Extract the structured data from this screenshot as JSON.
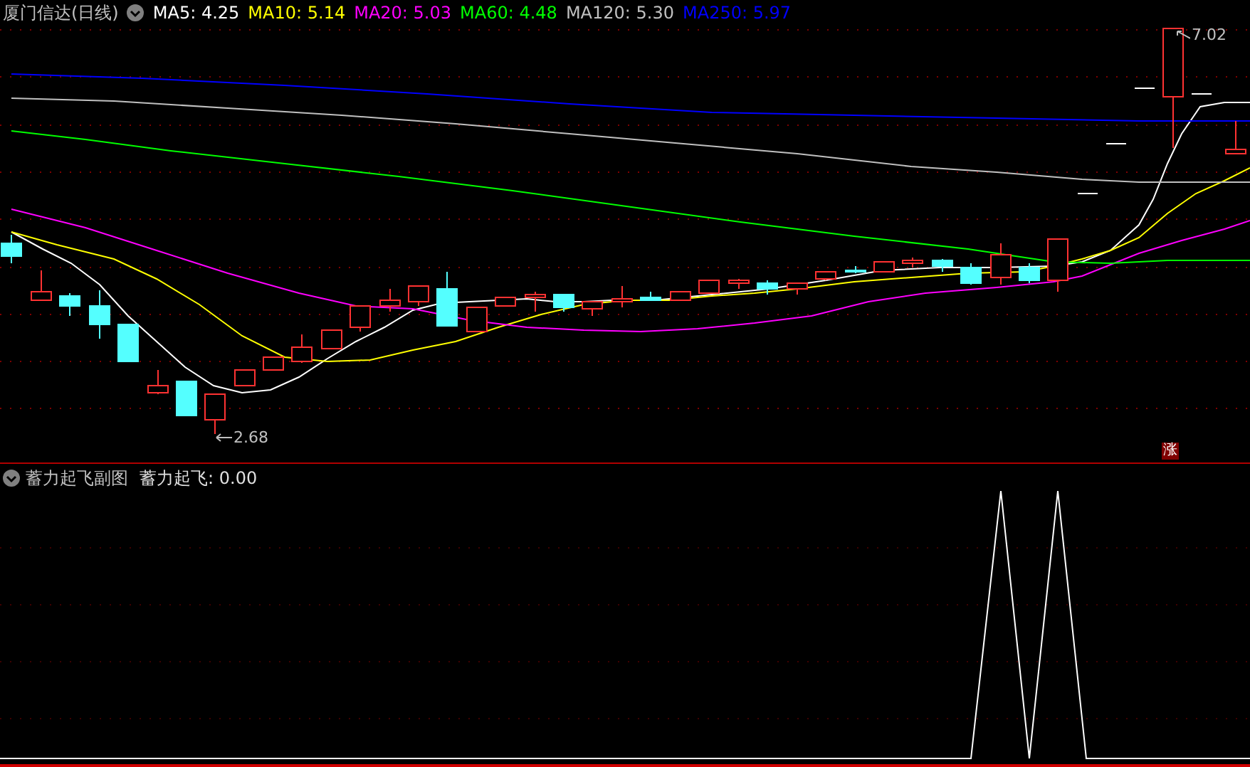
{
  "main_chart": {
    "title": "厦门信达(日线)",
    "indicators": [
      {
        "label": "MA5:",
        "value": "4.25",
        "color": "#ffffff"
      },
      {
        "label": "MA10:",
        "value": "5.14",
        "color": "#ffff00"
      },
      {
        "label": "MA20:",
        "value": "5.03",
        "color": "#ff00ff"
      },
      {
        "label": "MA60:",
        "value": "4.48",
        "color": "#00ff00"
      },
      {
        "label": "MA120:",
        "value": "5.30",
        "color": "#c0c0c0"
      },
      {
        "label": "MA250:",
        "value": "5.97",
        "color": "#0000ff"
      }
    ],
    "low_marker": "2.68",
    "high_marker": "7.02",
    "badge": "涨"
  },
  "sub_chart": {
    "title": "蓄力起飞副图",
    "indicator_label": "蓄力起飞:",
    "indicator_value": "0.00"
  }
}
